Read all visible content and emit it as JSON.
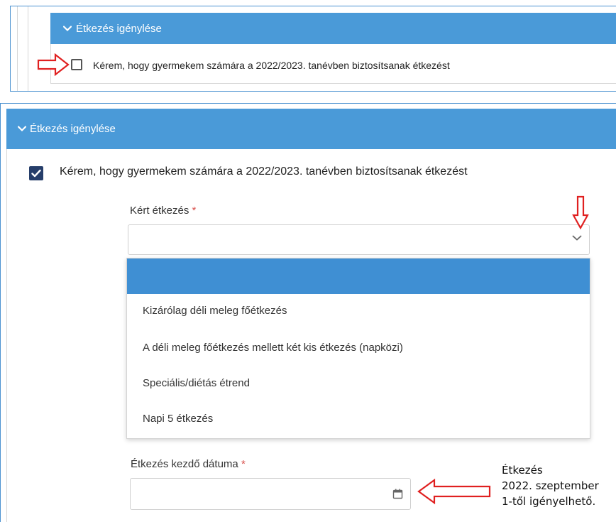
{
  "top_panel": {
    "header_title": "Étkezés igénylése",
    "checkbox_label": "Kérem, hogy gyermekem számára a 2022/2023. tanévben biztosítsanak étkezést",
    "checkbox_checked": false
  },
  "bottom_panel": {
    "header_title": "Étkezés igénylése",
    "checkbox_label": "Kérem, hogy gyermekem számára a 2022/2023. tanévben biztosítsanak étkezést",
    "checkbox_checked": true,
    "meal_field": {
      "label": "Kért étkezés",
      "required_mark": "*",
      "value": "",
      "options": [
        "",
        "Kizárólag déli meleg főétkezés",
        "A déli meleg főétkezés mellett két kis étkezés (napközi)",
        "Speciális/diétás étrend",
        "Napi 5 étkezés"
      ]
    },
    "start_date_field": {
      "label": "Étkezés kezdő dátuma",
      "required_mark": "*",
      "value": ""
    }
  },
  "annotation": {
    "line1": "Étkezés",
    "line2": "2022. szeptember",
    "line3": "1-től igényelhető."
  },
  "colors": {
    "header_bg": "#4a9ad8",
    "highlight_bg": "#3f8fd3",
    "checkbox_checked_bg": "#263e6a",
    "arrow_red": "#e02020",
    "required_red": "#d9534f"
  },
  "icons": {
    "header_chevron": "chevron-down-icon",
    "select_chevron": "chevron-down-icon",
    "date_picker": "calendar-icon",
    "checkmark": "checkmark-icon"
  }
}
